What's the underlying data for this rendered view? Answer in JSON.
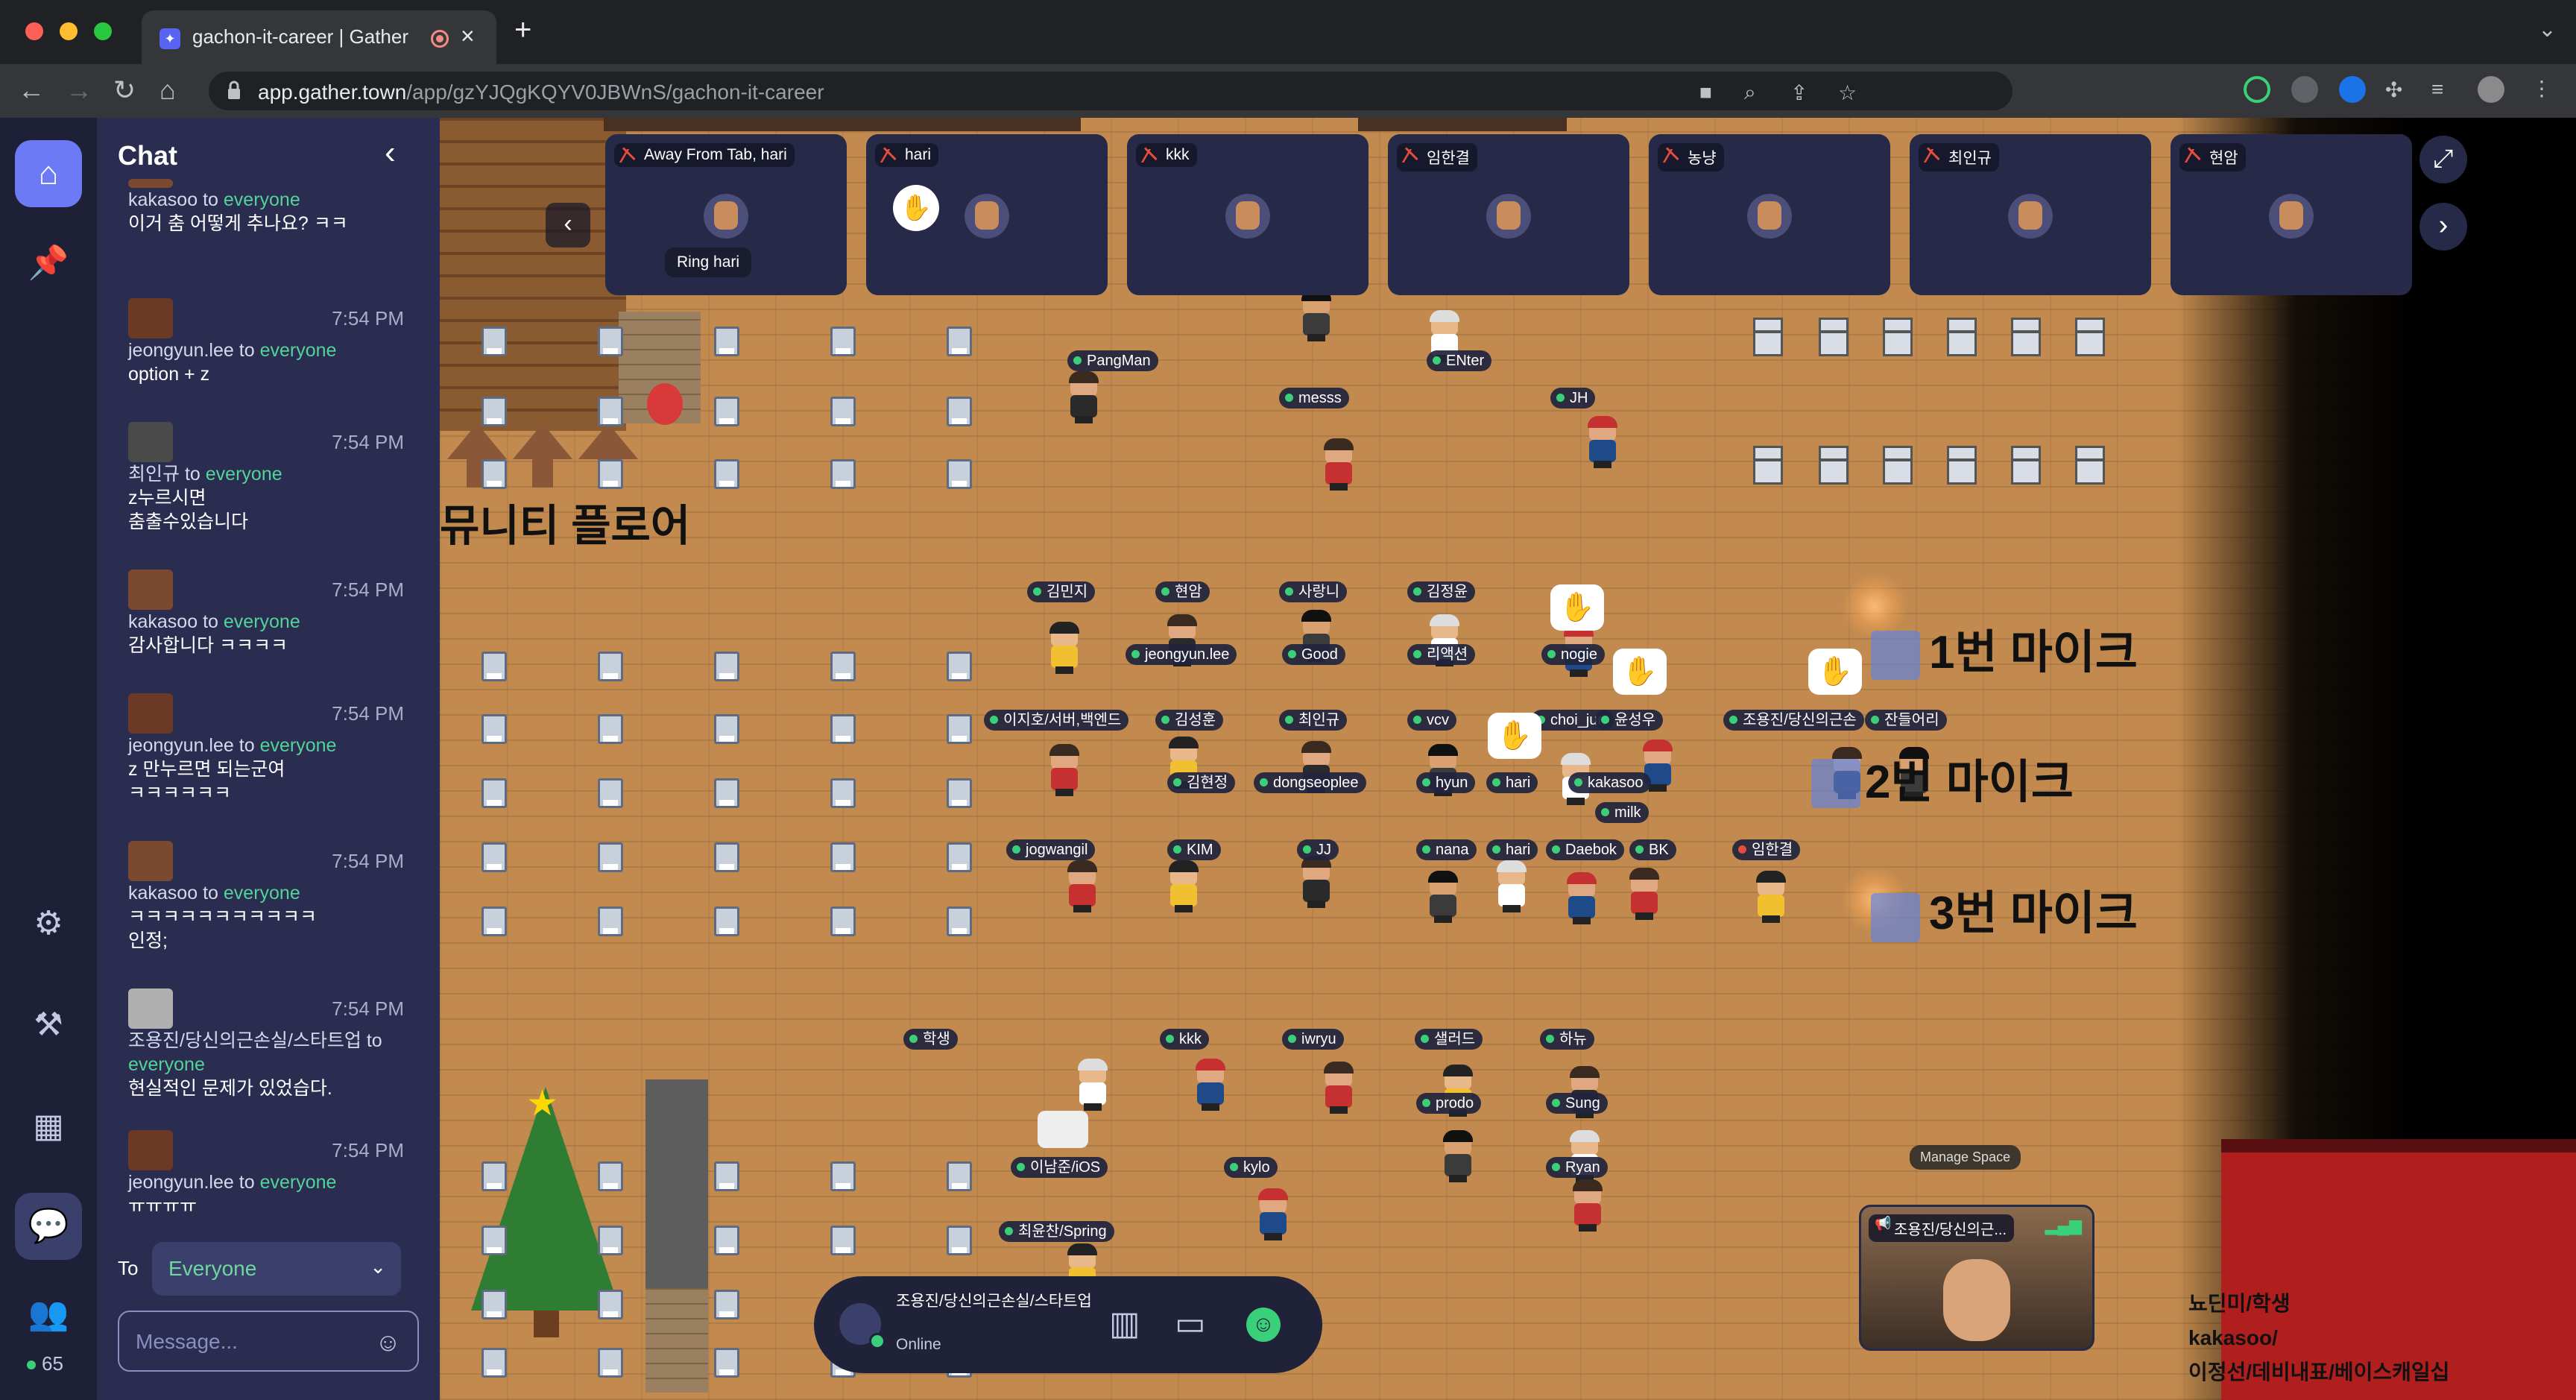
{
  "browser": {
    "tab_title": "gachon-it-career | Gather",
    "url_host": "app.gather.town",
    "url_path": "/app/gzYJQgKQYV0JBWnS/gachon-it-career"
  },
  "chat": {
    "title": "Chat",
    "to_label": "To",
    "to_value": "Everyone",
    "message_placeholder": "Message...",
    "messages": [
      {
        "sender": "kakasoo",
        "to": "to",
        "target": "everyone",
        "time": "",
        "body": "이거 춤 어떻게 추나요? ㅋㅋ"
      },
      {
        "sender": "jeongyun.lee",
        "to": "to",
        "target": "everyone",
        "time": "7:54 PM",
        "body": "option + z"
      },
      {
        "sender": "최인규",
        "to": "to",
        "target": "everyone",
        "time": "7:54 PM",
        "body": "z누르시면\n춤출수있습니다"
      },
      {
        "sender": "kakasoo",
        "to": "to",
        "target": "everyone",
        "time": "7:54 PM",
        "body": "감사합니다 ㅋㅋㅋㅋ"
      },
      {
        "sender": "jeongyun.lee",
        "to": "to",
        "target": "everyone",
        "time": "7:54 PM",
        "body": "z 만누르면 되는군여\nㅋㅋㅋㅋㅋㅋ"
      },
      {
        "sender": "kakasoo",
        "to": "to",
        "target": "everyone",
        "time": "7:54 PM",
        "body": "ㅋㅋㅋㅋㅋㅋㅋㅋㅋㅋㅋ\n인정;"
      },
      {
        "sender": "조용진/당신의근손실/스타트업",
        "to": "to",
        "target": "everyone",
        "time": "7:54 PM",
        "body": "현실적인 문제가 있었습다."
      },
      {
        "sender": "jeongyun.lee",
        "to": "to",
        "target": "everyone",
        "time": "7:54 PM",
        "body": "ㅠㅠㅠㅠ"
      }
    ]
  },
  "rail": {
    "online_count": "65"
  },
  "video_tiles": [
    {
      "name": "Away From Tab, hari",
      "ring_label": "Ring hari"
    },
    {
      "name": "hari"
    },
    {
      "name": "kkk"
    },
    {
      "name": "임한결"
    },
    {
      "name": "농냥"
    },
    {
      "name": "최인규"
    },
    {
      "name": "현암"
    }
  ],
  "map": {
    "area_sign": "뮤니티 플로어",
    "mic_labels": [
      "1번 마이크",
      "2번 마이크",
      "3번 마이크"
    ],
    "manage_space": "Manage Space",
    "booth_text": "뇨딘미/학생\nkakasoo/\n이정선/데비내표/베이스캐일십",
    "players": [
      {
        "name": "PangMan"
      },
      {
        "name": "messs"
      },
      {
        "name": "ENter"
      },
      {
        "name": "JH"
      },
      {
        "name": "김민지"
      },
      {
        "name": "현암"
      },
      {
        "name": "사랑니"
      },
      {
        "name": "김정윤"
      },
      {
        "name": "jeongyun.lee"
      },
      {
        "name": "Good"
      },
      {
        "name": "리액션"
      },
      {
        "name": "nogie"
      },
      {
        "name": "이지호/서버,백엔드"
      },
      {
        "name": "김성훈"
      },
      {
        "name": "최인규"
      },
      {
        "name": "vcv"
      },
      {
        "name": "choi_jun"
      },
      {
        "name": "윤성우"
      },
      {
        "name": "조용진/당신의근손"
      },
      {
        "name": "잔들어리"
      },
      {
        "name": "김현정"
      },
      {
        "name": "dongseoplee"
      },
      {
        "name": "hyun"
      },
      {
        "name": "hari"
      },
      {
        "name": "kakasoo"
      },
      {
        "name": "milk"
      },
      {
        "name": "jogwangil"
      },
      {
        "name": "KIM"
      },
      {
        "name": "JJ"
      },
      {
        "name": "nana"
      },
      {
        "name": "hari"
      },
      {
        "name": "Daebok"
      },
      {
        "name": "BK"
      },
      {
        "name": "임한결"
      },
      {
        "name": "학생"
      },
      {
        "name": "kkk"
      },
      {
        "name": "iwryu"
      },
      {
        "name": "샐러드"
      },
      {
        "name": "하뉴"
      },
      {
        "name": "prodo"
      },
      {
        "name": "Sung"
      },
      {
        "name": "이남준/iOS"
      },
      {
        "name": "kylo"
      },
      {
        "name": "Ryan"
      },
      {
        "name": "최윤찬/Spring"
      }
    ]
  },
  "dock": {
    "name": "조용진/당신의근손실/스타트업",
    "status": "Online"
  },
  "selfcam": {
    "label": "조용진/당신의근..."
  }
}
